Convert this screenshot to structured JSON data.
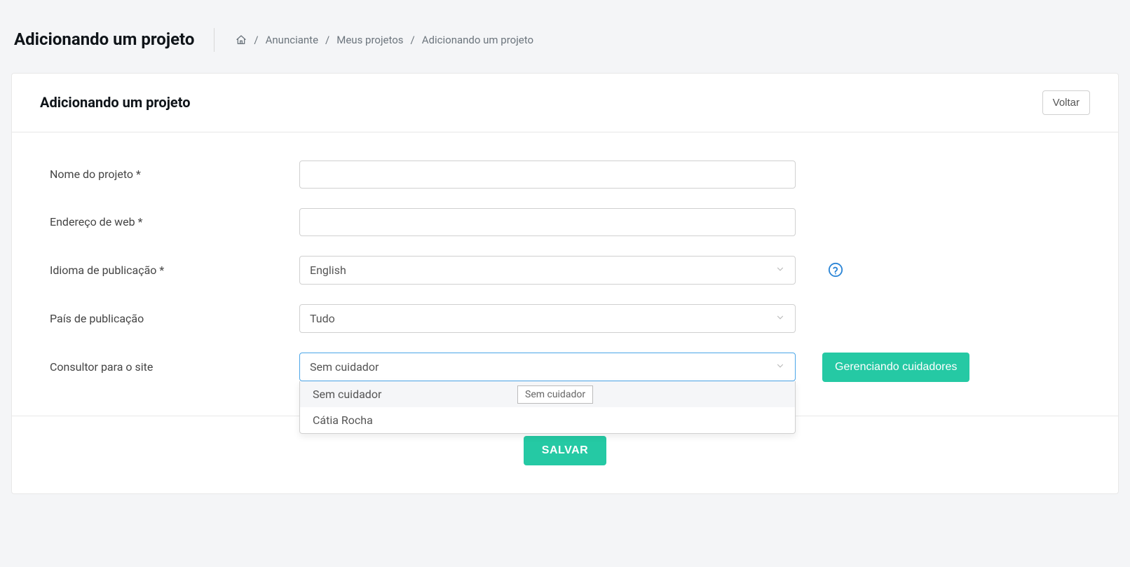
{
  "page": {
    "title": "Adicionando um projeto"
  },
  "breadcrumb": {
    "level1": "Anunciante",
    "level2": "Meus projetos",
    "current": "Adicionando um projeto"
  },
  "card": {
    "title": "Adicionando um projeto",
    "back_button": "Voltar"
  },
  "form": {
    "project_name": {
      "label": "Nome do projeto *",
      "value": ""
    },
    "web_address": {
      "label": "Endereço de web *",
      "value": ""
    },
    "publication_language": {
      "label": "Idioma de publicação *",
      "selected": "English"
    },
    "publication_country": {
      "label": "País de publicação",
      "selected": "Tudo"
    },
    "site_consultant": {
      "label": "Consultor para o site",
      "selected": "Sem cuidador",
      "options": [
        "Sem cuidador",
        "Cátia Rocha"
      ],
      "tooltip": "Sem cuidador",
      "manage_button": "Gerenciando cuidadores"
    }
  },
  "footer": {
    "save_button": "SALVAR"
  }
}
